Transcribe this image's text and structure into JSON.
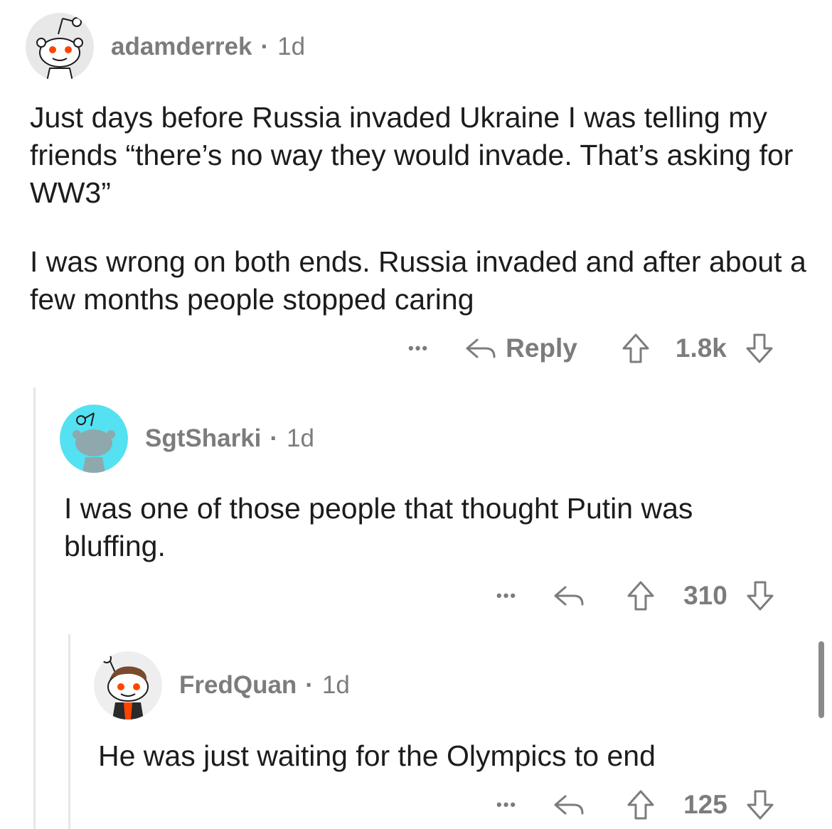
{
  "comments": [
    {
      "username": "adamderrek",
      "age": "1d",
      "paragraphs": [
        "Just days before Russia invaded Ukraine I was telling my friends “there’s no way they would invade. That’s asking for WW3”",
        "I was wrong on both ends. Russia invaded and after about a few months people stopped caring"
      ],
      "more_label": "•••",
      "reply_label": "Reply",
      "score": "1.8k",
      "avatar_color": "#e8e8e8"
    },
    {
      "username": "SgtSharki",
      "age": "1d",
      "paragraphs": [
        "I was one of those people that thought Putin was bluffing."
      ],
      "more_label": "•••",
      "score": "310",
      "avatar_color": "#54e1f2"
    },
    {
      "username": "FredQuan",
      "age": "1d",
      "paragraphs": [
        "He was just waiting for the Olympics to end"
      ],
      "more_label": "•••",
      "score": "125",
      "avatar_color": "#eeeeee"
    }
  ],
  "colors": {
    "text": "#1c1c1c",
    "meta": "#7c7c7c",
    "snoo_eye": "#ff4500",
    "thread_line": "#e6e6e6"
  },
  "icons": [
    "more-icon",
    "reply-icon",
    "upvote-icon",
    "downvote-icon",
    "snoo-avatar-icon"
  ]
}
